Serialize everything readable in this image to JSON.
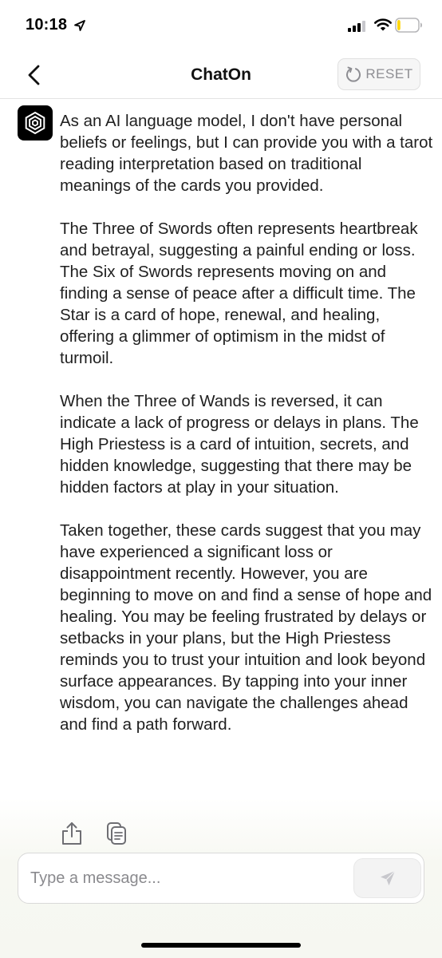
{
  "status_bar": {
    "time": "10:18",
    "location_icon": "location-arrow-icon",
    "signal_icon": "cellular-signal-icon",
    "wifi_icon": "wifi-icon",
    "battery_icon": "battery-low-icon",
    "battery_level": 0.15,
    "battery_color": "#ffd60a"
  },
  "header": {
    "back_icon": "chevron-left-icon",
    "title": "ChatOn",
    "reset_icon": "refresh-icon",
    "reset_label": "RESET"
  },
  "message": {
    "avatar_icon": "chaton-logo-icon",
    "paragraphs": [
      "As an AI language model, I don't have personal beliefs or feelings, but I can provide you with a tarot reading interpretation based on traditional meanings of the cards you provided.",
      "The Three of Swords often represents heartbreak and betrayal, suggesting a painful ending or loss. The Six of Swords represents moving on and finding a sense of peace after a difficult time. The Star is a card of hope, renewal, and healing, offering a glimmer of optimism in the midst of turmoil.",
      "When the Three of Wands is reversed, it can indicate a lack of progress or delays in plans. The High Priestess is a card of intuition, secrets, and hidden knowledge, suggesting that there may be hidden factors at play in your situation.",
      "Taken together, these cards suggest that you may have experienced a significant loss or disappointment recently. However, you are beginning to move on and find a sense of hope and healing. You may be feeling frustrated by delays or setbacks in your plans, but the High Priestess reminds you to trust your intuition and look beyond surface appearances. By tapping into your inner wisdom, you can navigate the challenges ahead and find a path forward."
    ],
    "actions": [
      "share-icon",
      "copy-icon"
    ]
  },
  "composer": {
    "placeholder": "Type a message...",
    "value": "",
    "send_icon": "send-icon"
  }
}
